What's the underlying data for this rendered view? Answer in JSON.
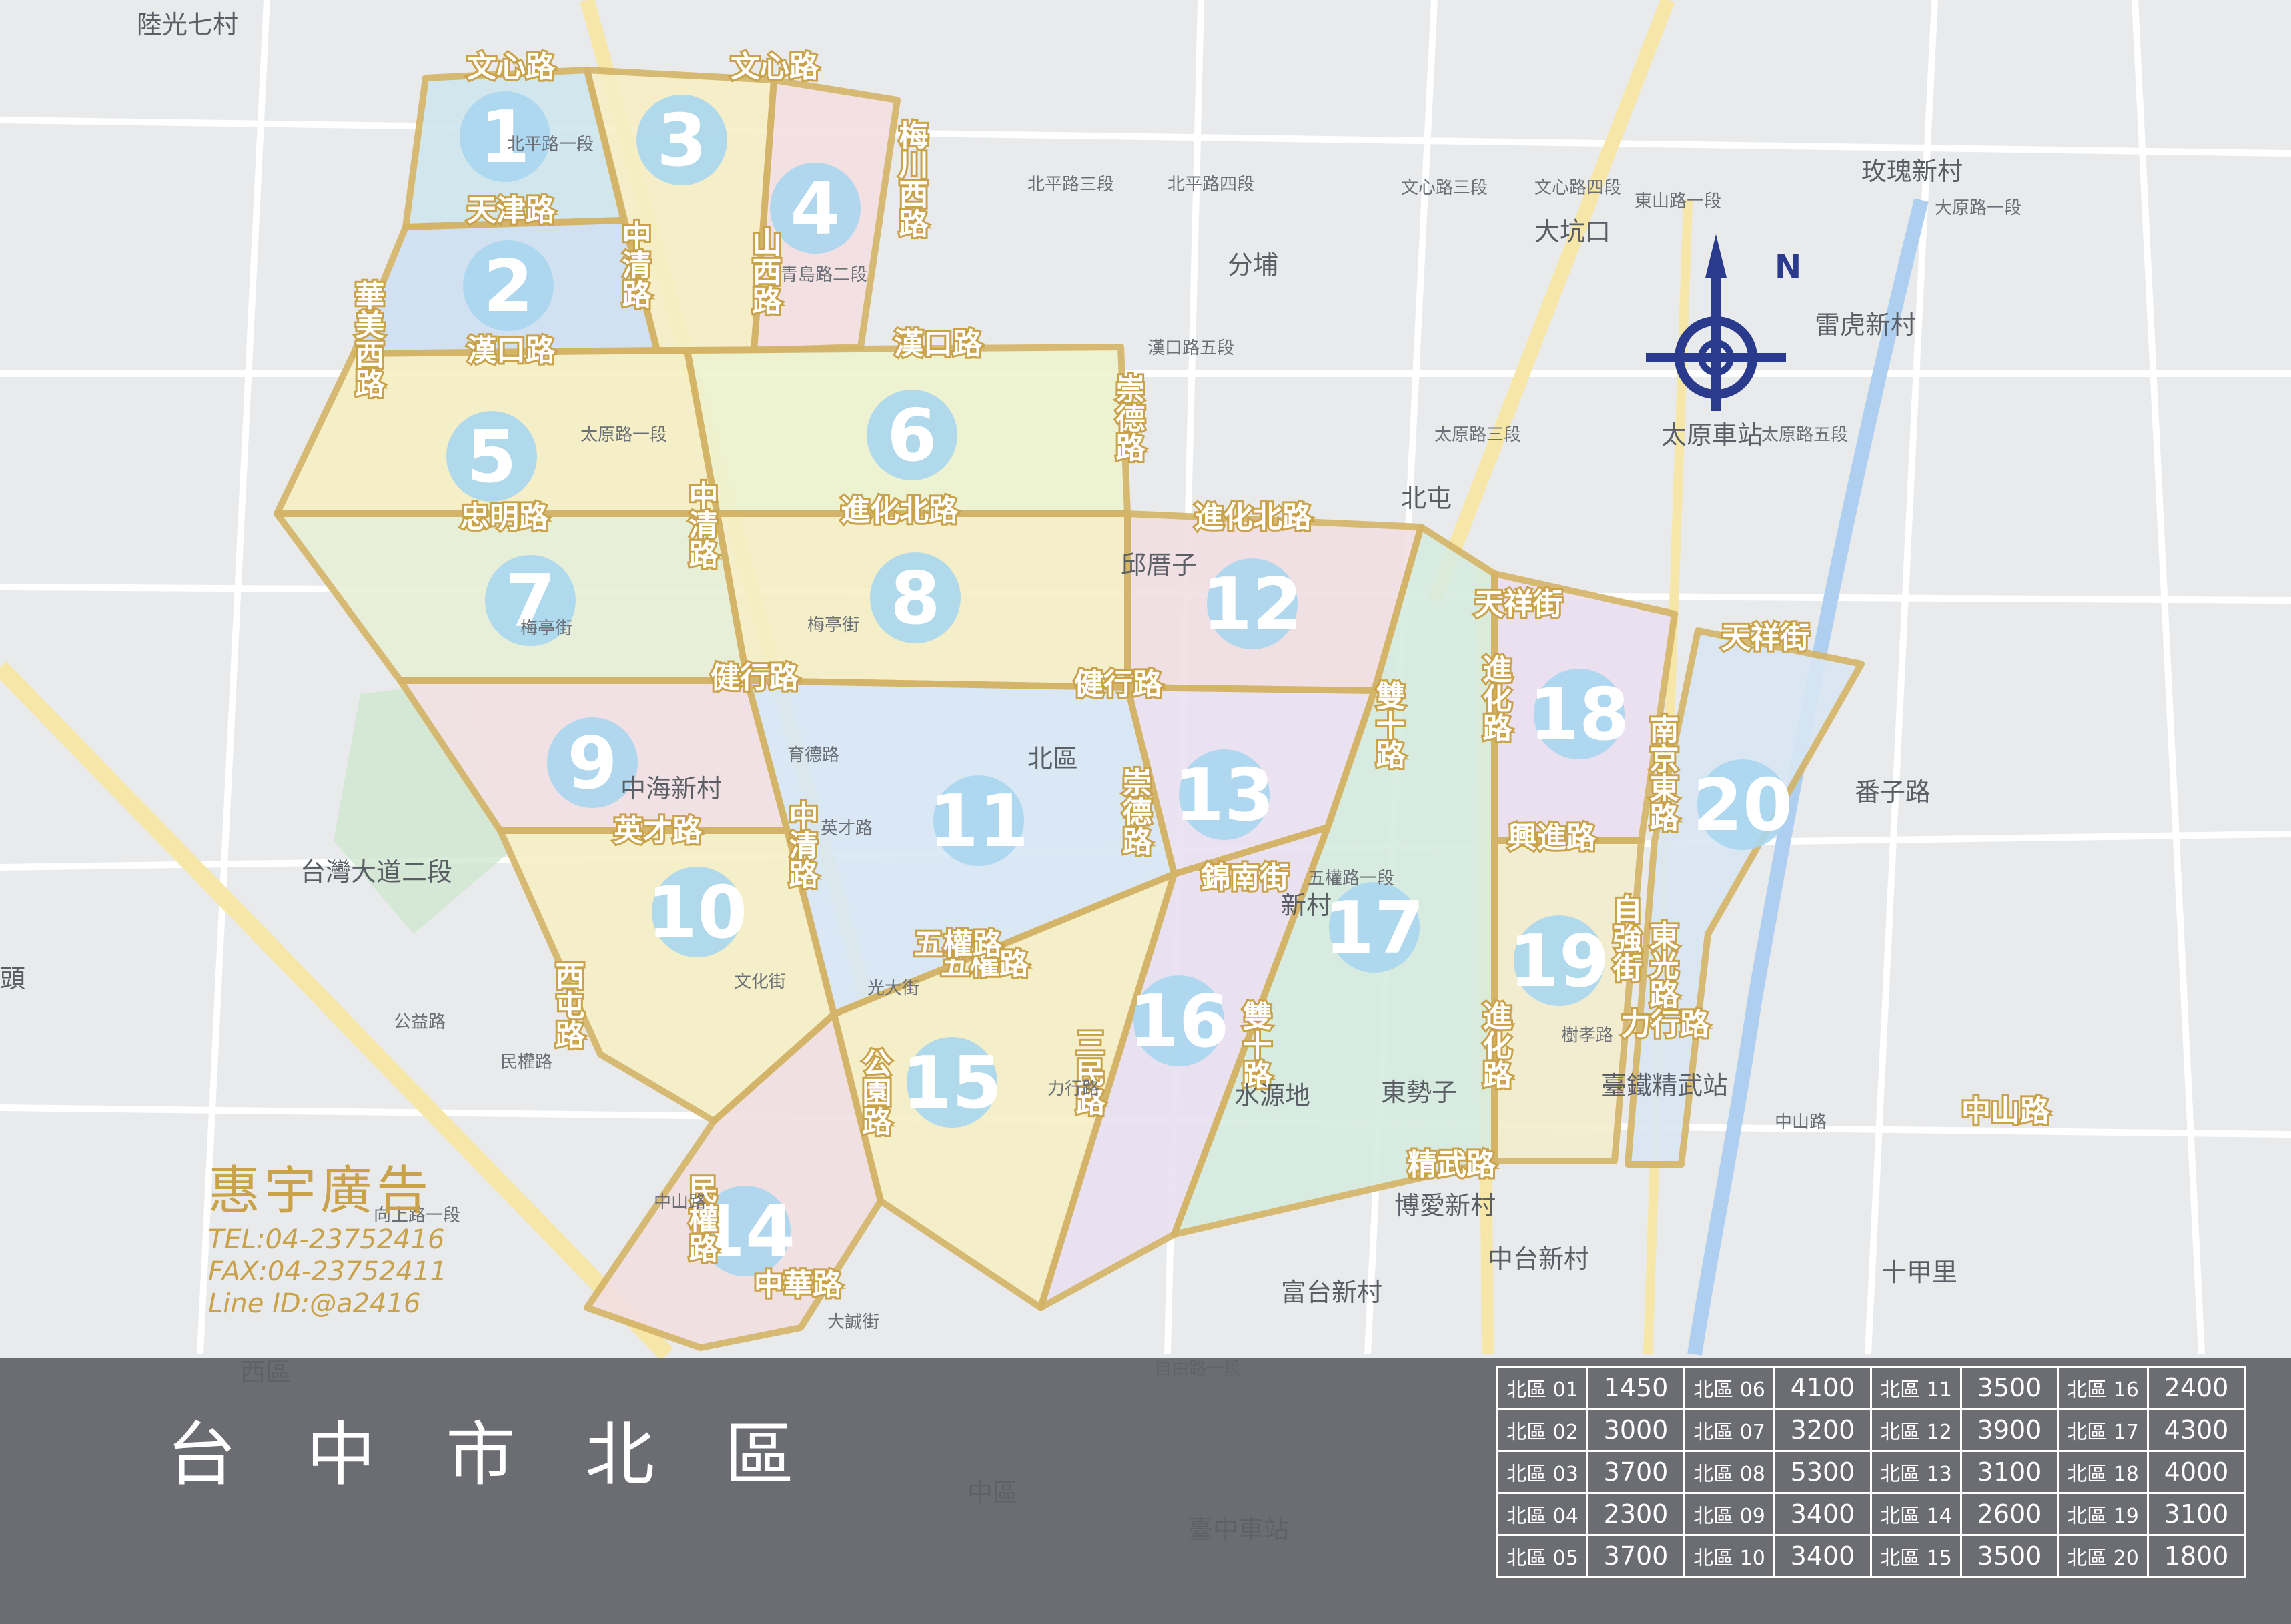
{
  "title": "台 中 市   北 區",
  "advertiser": {
    "name": "惠宇廣告",
    "tel": "TEL:04-23752416",
    "fax": "FAX:04-23752411",
    "line": "Line ID:@a2416"
  },
  "compass": {
    "north_label": "N"
  },
  "colors": {
    "boundary": "#d4b467",
    "label_stroke": "#c9a24a",
    "number_circle": "#a9d6ee",
    "bar": "#5f6268"
  },
  "regions": [
    {
      "num": "1",
      "fill": "#cfe6ee"
    },
    {
      "num": "2",
      "fill": "#cfe1f2"
    },
    {
      "num": "3",
      "fill": "#f7efc6"
    },
    {
      "num": "4",
      "fill": "#f3dfe2"
    },
    {
      "num": "5",
      "fill": "#f6f0c4"
    },
    {
      "num": "6",
      "fill": "#eef3cf"
    },
    {
      "num": "7",
      "fill": "#e8f0d8"
    },
    {
      "num": "8",
      "fill": "#f6efc6"
    },
    {
      "num": "9",
      "fill": "#f3e1e4"
    },
    {
      "num": "10",
      "fill": "#f6f0c6"
    },
    {
      "num": "11",
      "fill": "#d8e8f5"
    },
    {
      "num": "12",
      "fill": "#f1dfe3"
    },
    {
      "num": "13",
      "fill": "#ece2f2"
    },
    {
      "num": "14",
      "fill": "#f2dfe1"
    },
    {
      "num": "15",
      "fill": "#f6f0c6"
    },
    {
      "num": "16",
      "fill": "#eae1f1"
    },
    {
      "num": "17",
      "fill": "#d7ecdf"
    },
    {
      "num": "18",
      "fill": "#ece0f0"
    },
    {
      "num": "19",
      "fill": "#f4eecd"
    },
    {
      "num": "20",
      "fill": "#d9e7f4"
    }
  ],
  "road_labels": [
    "文心路",
    "文心路",
    "天津路",
    "漢口路",
    "漢口路",
    "忠明路",
    "進化北路",
    "進化北路",
    "健行路",
    "健行路",
    "英才路",
    "五權路",
    "中清路",
    "中清路",
    "中清路",
    "華美西路",
    "梅川西路",
    "山西路",
    "崇德路",
    "崇德路",
    "雙十路",
    "雙十路",
    "錦南街",
    "進化路",
    "進化路",
    "天祥街",
    "天祥街",
    "南京東路",
    "東光路",
    "興進路",
    "三民路",
    "公園路",
    "精武路",
    "五權路",
    "中華路",
    "民權路",
    "西屯路",
    "力行路",
    "自強街",
    "中山路"
  ],
  "place_labels": [
    "陸光七村",
    "大坑口",
    "分埔",
    "玫瑰新村",
    "雷虎新村",
    "番子路",
    "北屯",
    "邱厝子",
    "中海新村",
    "北區",
    "新村",
    "水源地",
    "東勢子",
    "博愛新村",
    "中台新村",
    "富台新村",
    "十甲里",
    "頭",
    "西區",
    "中區",
    "臺中車站",
    "太原車站",
    "臺鐵精武站",
    "台灣大道二段"
  ],
  "street_labels": [
    "北平路一段",
    "北平路四段",
    "北平路三段",
    "文心路四段",
    "文心路三段",
    "大原路一段",
    "太原路一段",
    "太原路三段",
    "太原路五段",
    "漢口路五段",
    "青島路二段",
    "梅亭街",
    "梅亭街",
    "育德路",
    "英才路",
    "文化街",
    "向上路一段",
    "公益路",
    "中山路",
    "東山路一段",
    "民權路",
    "五權路一段",
    "自由路一段",
    "中山路",
    "力行路",
    "樹孝路",
    "大誠街",
    "光大街"
  ],
  "price_rows": [
    [
      {
        "name": "北區 01",
        "price": "1450"
      },
      {
        "name": "北區 06",
        "price": "4100"
      },
      {
        "name": "北區 11",
        "price": "3500"
      },
      {
        "name": "北區 16",
        "price": "2400"
      }
    ],
    [
      {
        "name": "北區 02",
        "price": "3000"
      },
      {
        "name": "北區 07",
        "price": "3200"
      },
      {
        "name": "北區 12",
        "price": "3900"
      },
      {
        "name": "北區 17",
        "price": "4300"
      }
    ],
    [
      {
        "name": "北區 03",
        "price": "3700"
      },
      {
        "name": "北區 08",
        "price": "5300"
      },
      {
        "name": "北區 13",
        "price": "3100"
      },
      {
        "name": "北區 18",
        "price": "4000"
      }
    ],
    [
      {
        "name": "北區 04",
        "price": "2300"
      },
      {
        "name": "北區 09",
        "price": "3400"
      },
      {
        "name": "北區 14",
        "price": "2600"
      },
      {
        "name": "北區 19",
        "price": "3100"
      }
    ],
    [
      {
        "name": "北區 05",
        "price": "3700"
      },
      {
        "name": "北區 10",
        "price": "3400"
      },
      {
        "name": "北區 15",
        "price": "3500"
      },
      {
        "name": "北區 20",
        "price": "1800"
      }
    ]
  ]
}
